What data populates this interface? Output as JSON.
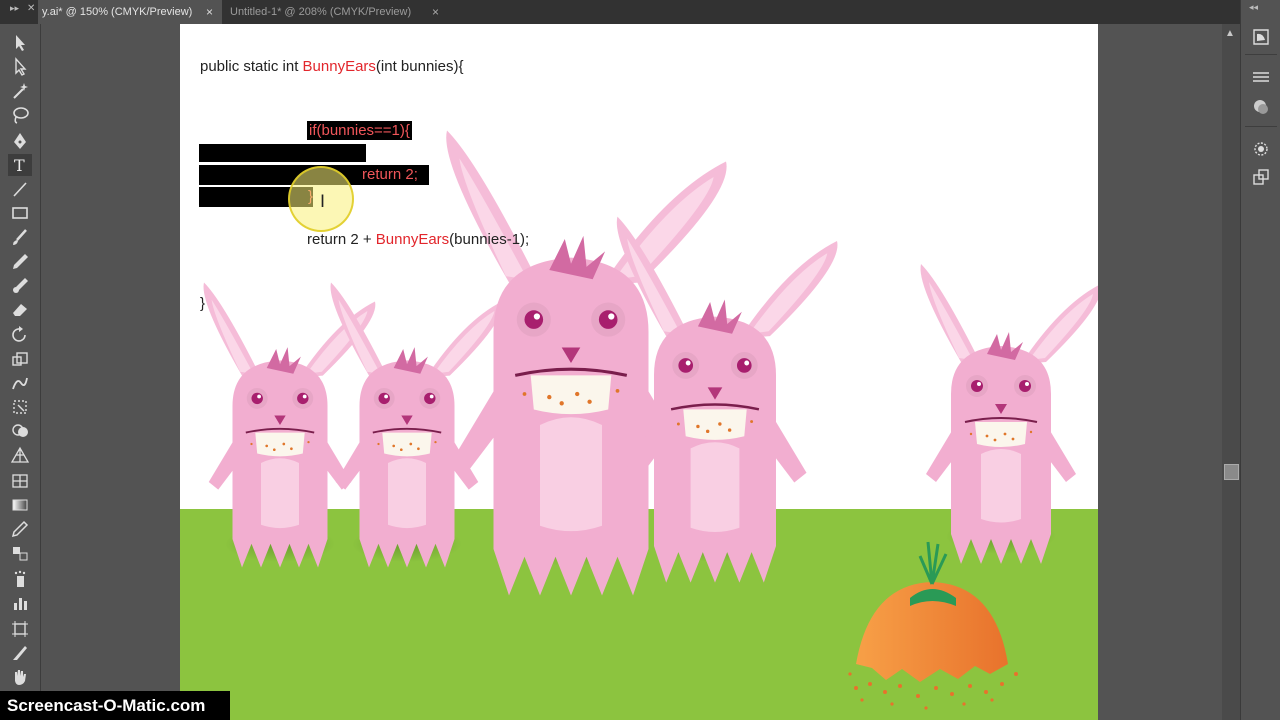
{
  "tabs": [
    {
      "label": "y.ai* @ 150% (CMYK/Preview)",
      "close": "×"
    },
    {
      "label": "Untitled-1* @ 208% (CMYK/Preview)",
      "close": "×"
    }
  ],
  "code": {
    "line1_a": "public static int ",
    "line1_fn": "BunnyEars",
    "line1_b": "(int bunnies){",
    "if_line": "if(bunnies==1){",
    "return1": "return 2;",
    "close_brace_inner": "}",
    "return2_a": "return 2 + ",
    "return2_fn": "BunnyEars",
    "return2_b": "(bunnies-1);",
    "close_brace_outer": "}"
  },
  "colors": {
    "accent_code": "#e2262c",
    "ground": "#8cc43f",
    "bunny_body": "#f2aed0",
    "carrot": "#f08a3c"
  },
  "tools": [
    "selection-tool-icon",
    "direct-selection-tool-icon",
    "magic-wand-icon",
    "lasso-icon",
    "pen-tool-icon",
    "type-tool-icon",
    "line-tool-icon",
    "rectangle-tool-icon",
    "paintbrush-icon",
    "pencil-icon",
    "blob-brush-icon",
    "eraser-icon",
    "rotate-tool-icon",
    "scale-tool-icon",
    "warp-tool-icon",
    "free-transform-icon",
    "shape-builder-icon",
    "perspective-grid-icon",
    "mesh-tool-icon",
    "gradient-tool-icon",
    "eyedropper-icon",
    "blend-tool-icon",
    "symbol-sprayer-icon",
    "column-graph-icon",
    "artboard-tool-icon",
    "slice-tool-icon",
    "hand-tool-icon"
  ],
  "panels": [
    "navigator-icon",
    "layers-menu-icon",
    "align-icon",
    "color-icon",
    "appearance-icon",
    "symbols-icon"
  ],
  "watermark": "Screencast-O-Matic.com"
}
